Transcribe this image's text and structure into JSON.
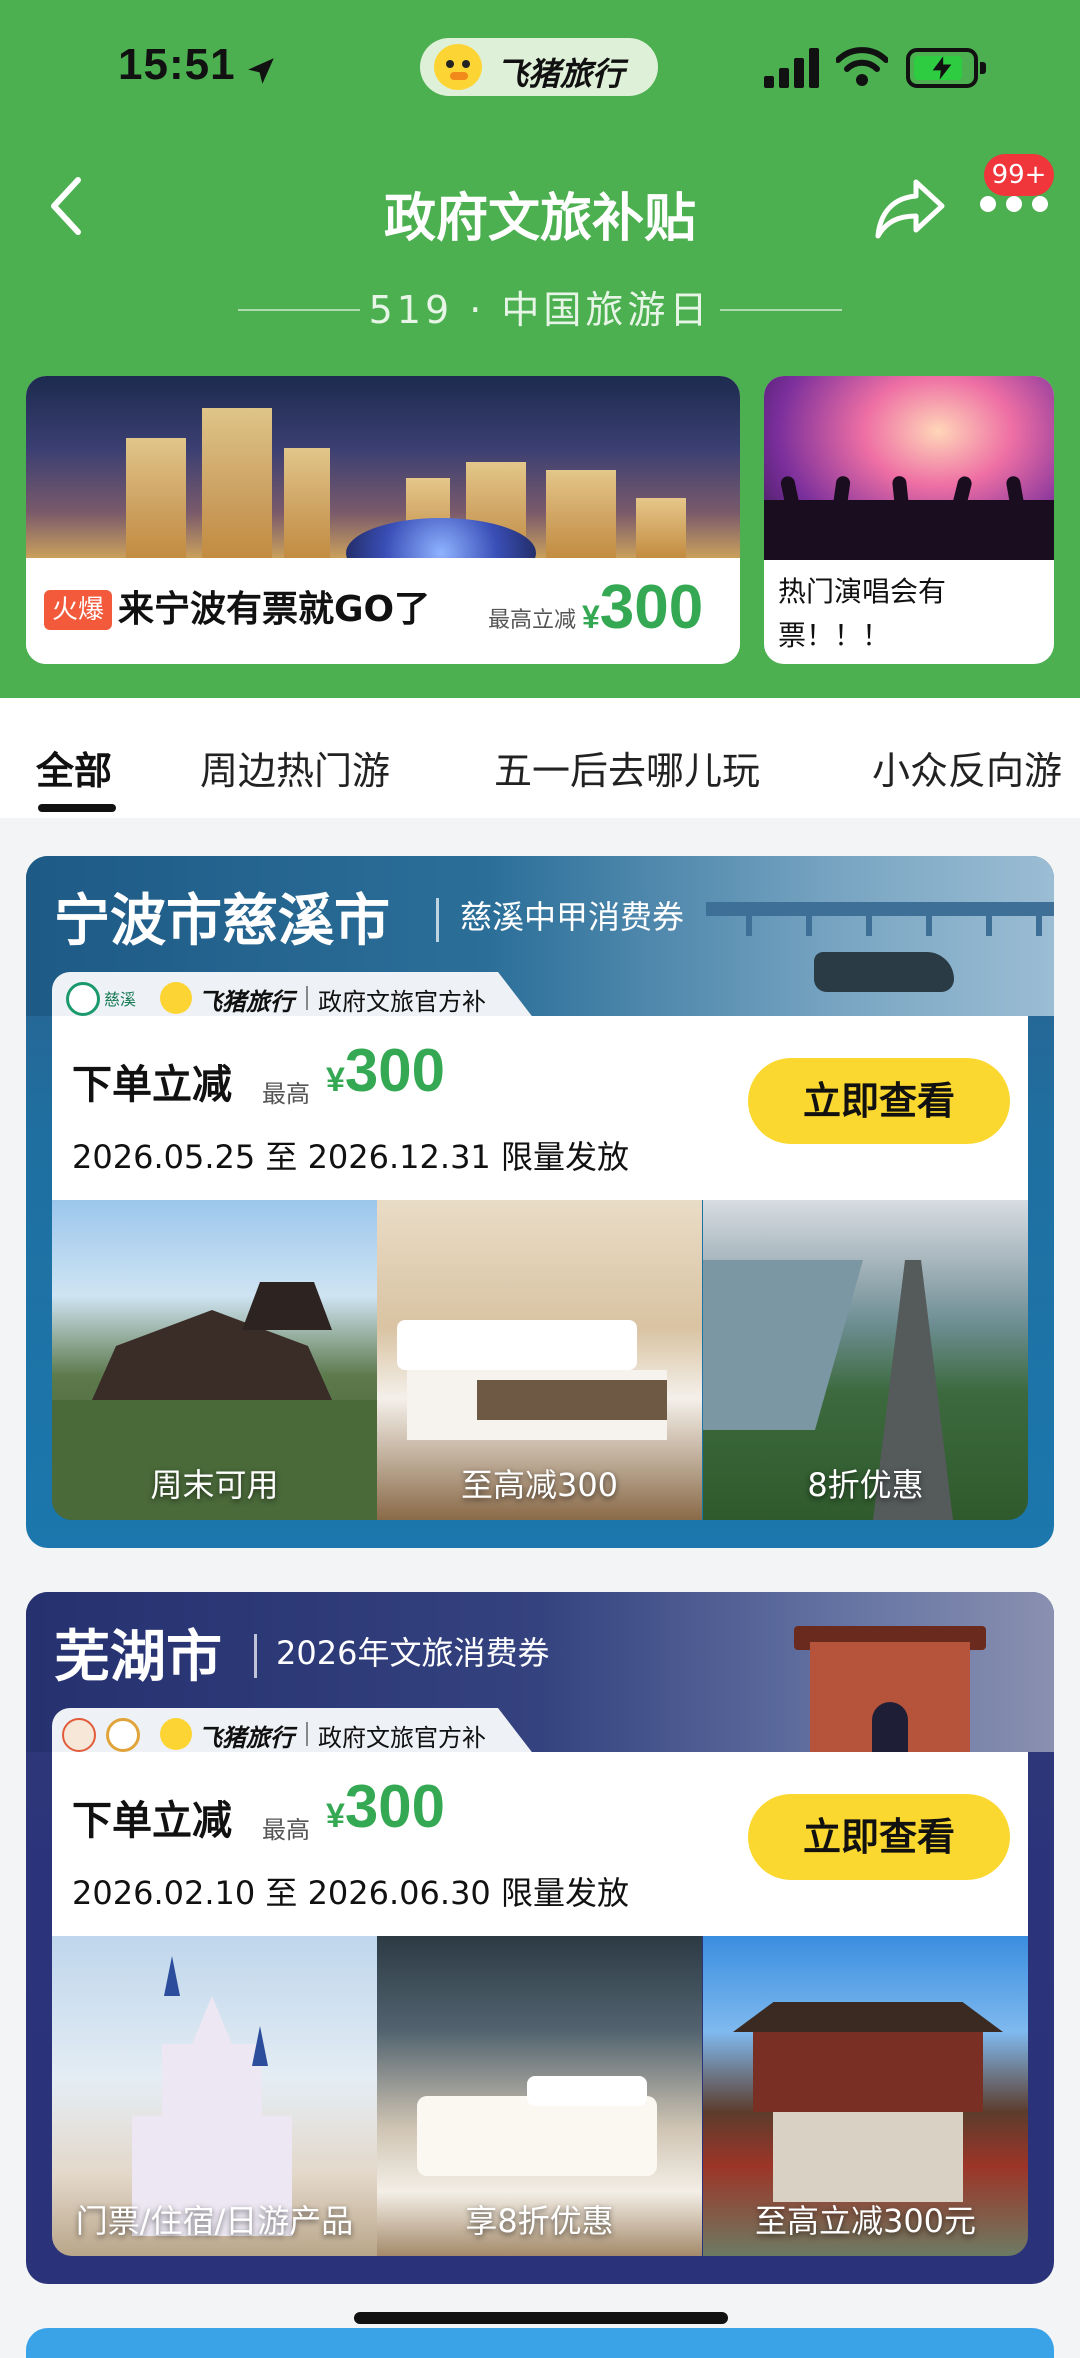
{
  "status_bar": {
    "time": "15:51",
    "app_name": "飞猪旅行"
  },
  "header": {
    "title": "政府文旅补贴",
    "notification_badge": "99+",
    "subtitle": "519 · 中国旅游日"
  },
  "banners": {
    "main": {
      "tag": "火爆",
      "text": "来宁波有票就GO了",
      "max_label": "最高立减",
      "currency": "¥",
      "amount": "300"
    },
    "side": {
      "text": "热门演唱会有票！！！"
    }
  },
  "tabs": [
    "全部",
    "周边热门游",
    "五一后去哪儿玩",
    "小众反向游"
  ],
  "active_tab": 0,
  "cards": [
    {
      "city": "宁波市慈溪市",
      "coupon": "慈溪中甲消费券",
      "partner_logo_text": "慈溪",
      "brand": "飞猪旅行",
      "partner_label": "政府文旅官方补贴",
      "title": "下单立减",
      "max_label": "最高",
      "currency": "¥",
      "amount": "300",
      "dates": "2026.05.25 至 2026.12.31 限量发放",
      "cta": "立即查看",
      "photos": [
        "周末可用",
        "至高减300",
        "8折优惠"
      ]
    },
    {
      "city": "芜湖市",
      "coupon": "2026年文旅消费券",
      "partner_logo_text": "",
      "brand": "飞猪旅行",
      "partner_label": "政府文旅官方补贴",
      "title": "下单立减",
      "max_label": "最高",
      "currency": "¥",
      "amount": "300",
      "dates": "2026.02.10 至 2026.06.30 限量发放",
      "cta": "立即查看",
      "photos": [
        "门票/住宿/日游产品",
        "享8折优惠",
        "至高立减300元"
      ]
    }
  ],
  "colors": {
    "header_green": "#4caf50",
    "price_green": "#35a853",
    "cta_yellow": "#fbd82f",
    "hot_red": "#f25a3b",
    "badge_red": "#f0353b"
  }
}
